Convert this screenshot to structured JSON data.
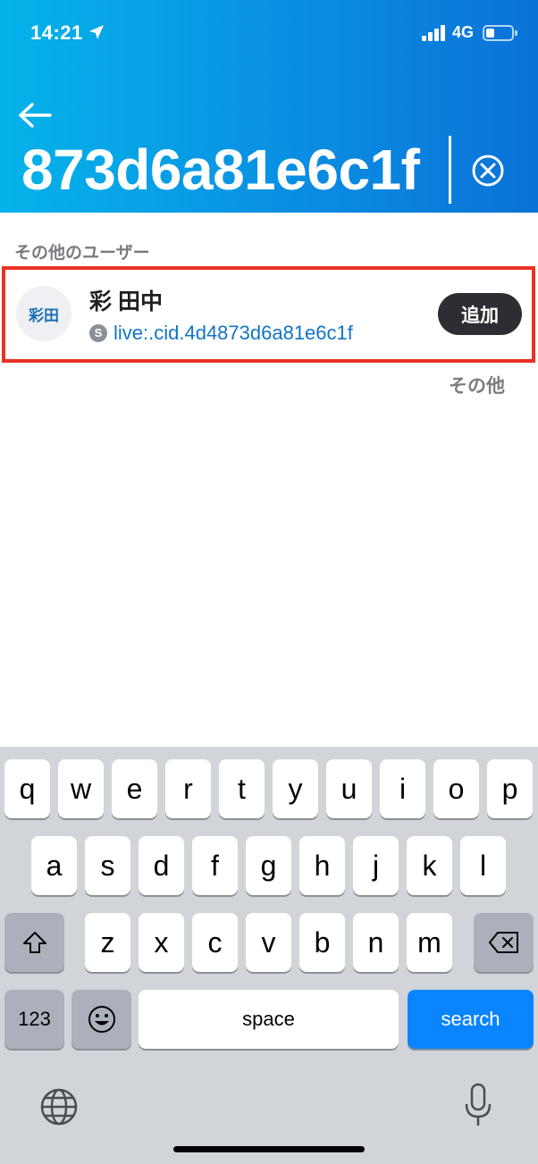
{
  "status_bar": {
    "time": "14:21",
    "network": "4G",
    "icons": [
      "location-arrow-icon",
      "signal-bars-icon",
      "battery-icon"
    ]
  },
  "header": {
    "back_icon": "arrow-left-icon",
    "search_value": "873d6a81e6c1f",
    "clear_icon": "circle-x-icon",
    "background_colors": [
      "#05b3ea",
      "#0b72d8"
    ]
  },
  "results": {
    "section_title": "その他のユーザー",
    "items": [
      {
        "avatar_text": "彩田",
        "name": "彩 田中",
        "badge": "S",
        "skype_id": "live:.cid.4d4873d6a81e6c1f",
        "action_label": "追加"
      }
    ],
    "more_label": "その他",
    "highlight_color": "#e83223"
  },
  "keyboard": {
    "row1": [
      "q",
      "w",
      "e",
      "r",
      "t",
      "y",
      "u",
      "i",
      "o",
      "p"
    ],
    "row2": [
      "a",
      "s",
      "d",
      "f",
      "g",
      "h",
      "j",
      "k",
      "l"
    ],
    "row3": [
      "z",
      "x",
      "c",
      "v",
      "b",
      "n",
      "m"
    ],
    "numbers_label": "123",
    "space_label": "space",
    "search_label": "search",
    "icons": [
      "shift-icon",
      "backspace-icon",
      "emoji-icon",
      "globe-icon",
      "microphone-icon"
    ]
  }
}
